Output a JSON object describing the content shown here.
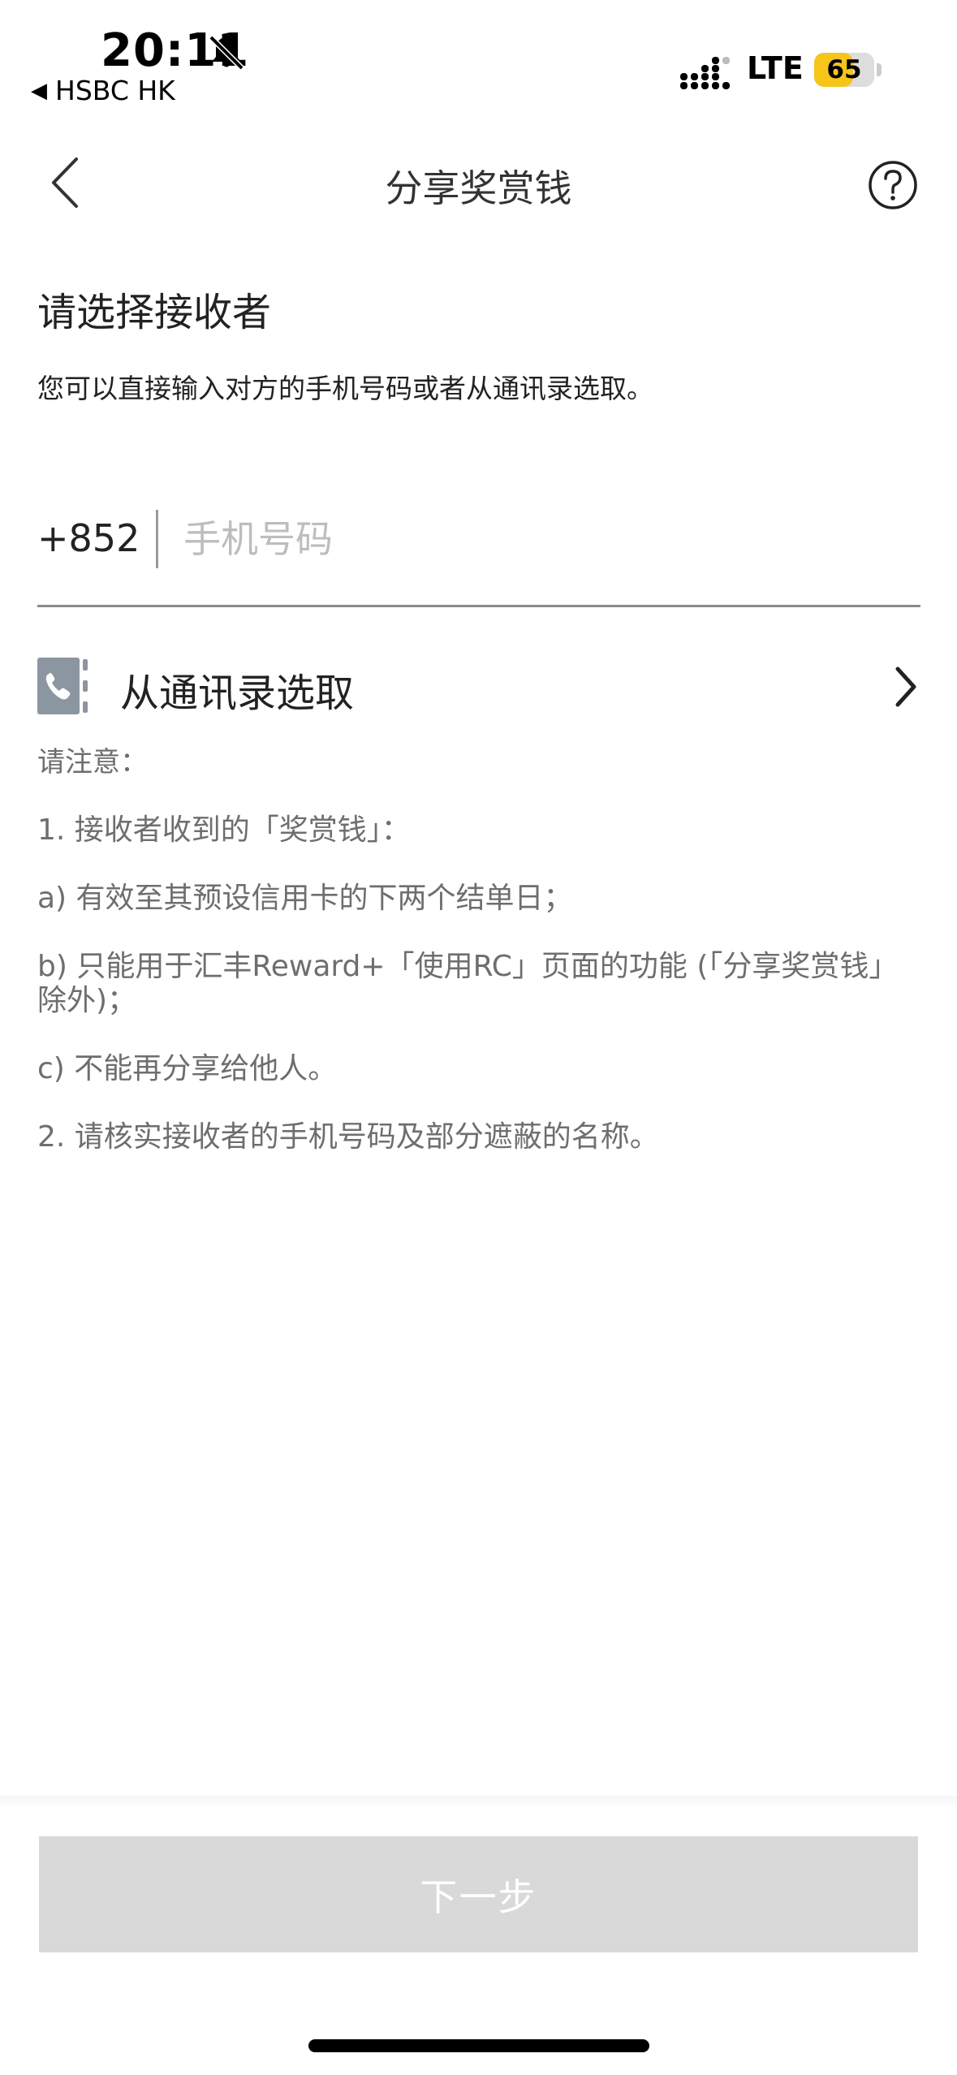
{
  "status_bar": {
    "time": "20:11",
    "back_app": "HSBC HK",
    "network": "LTE",
    "battery": "65",
    "battery_level_percent": 65,
    "battery_color": "#f5c518"
  },
  "header": {
    "title": "分享奖赏钱",
    "back_icon": "chevron-left-icon",
    "help_icon": "question-circle-icon"
  },
  "section": {
    "heading": "请选择接收者",
    "description": "您可以直接输入对方的手机号码或者从通讯录选取。"
  },
  "phone_input": {
    "country_code": "+852",
    "value": "",
    "placeholder": "手机号码"
  },
  "contacts": {
    "label": "从通讯录选取",
    "icon": "contacts-book-icon"
  },
  "notes": {
    "title": "请注意：",
    "items": [
      "1. 接收者收到的「奖赏钱」：",
      "a) 有效至其预设信用卡的下两个结单日；",
      "b) 只能用于汇丰Reward+「使用RC」页面的功能 (「分享奖赏钱」除外)；",
      "c) 不能再分享给他人。",
      "2. 请核实接收者的手机号码及部分遮蔽的名称。"
    ]
  },
  "footer": {
    "next_label": "下一步"
  },
  "colors": {
    "disabled_button": "#d9d9d9",
    "note_text": "#6e6e6e",
    "placeholder": "#bdbdbd"
  }
}
